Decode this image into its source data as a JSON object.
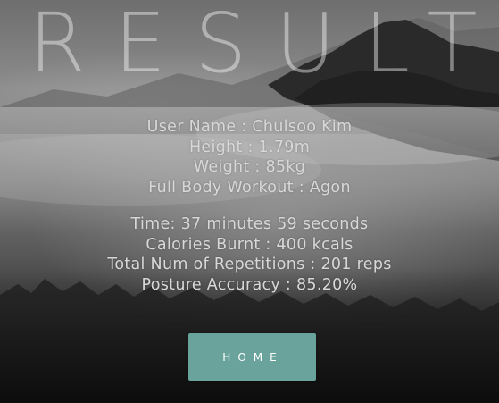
{
  "page": {
    "title": "RESULT"
  },
  "profile": {
    "user_name": "User Name : Chulsoo Kim",
    "height": "Height : 1.79m",
    "weight": "Weight : 85kg",
    "workout": "Full Body Workout : Agon"
  },
  "stats": {
    "time": "Time: 37 minutes 59 seconds",
    "calories": "Calories Burnt : 400 kcals",
    "repetitions": "Total Num of Repetitions : 201 reps",
    "accuracy": "Posture Accuracy : 85.20%"
  },
  "actions": {
    "home_label": "HOME"
  },
  "colors": {
    "button": "#6aa39b",
    "text": "#d8d8d8"
  }
}
